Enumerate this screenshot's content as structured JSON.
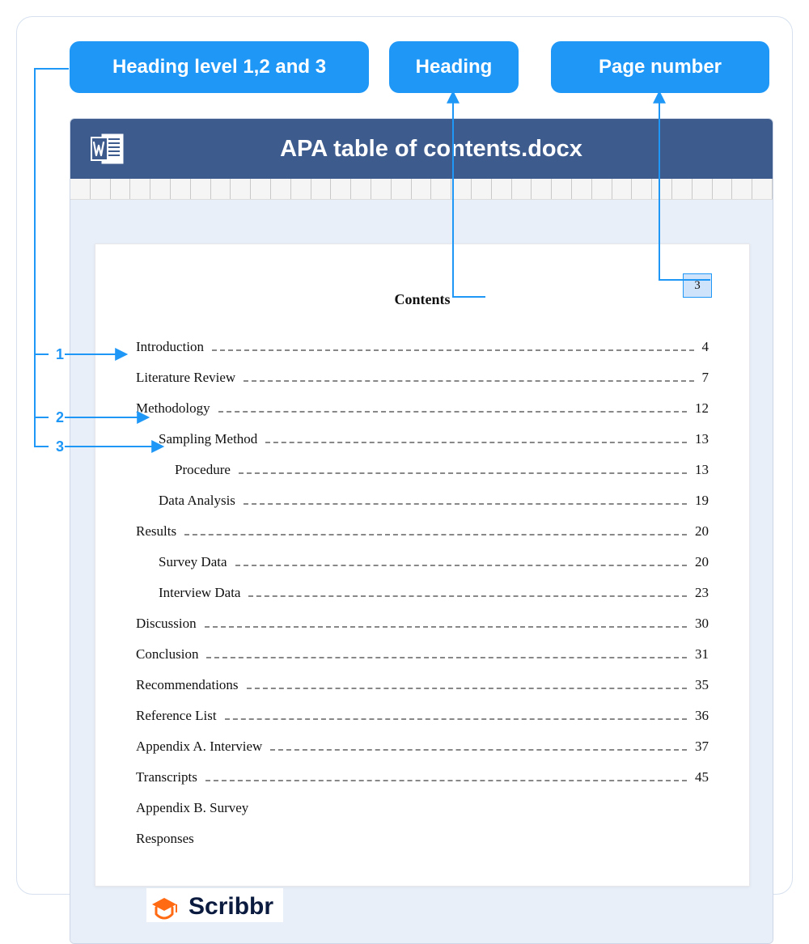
{
  "callouts": {
    "levels": "Heading level 1,2 and 3",
    "heading": "Heading",
    "pagenum": "Page number"
  },
  "level_markers": {
    "one": "1",
    "two": "2",
    "three": "3"
  },
  "document": {
    "filename": "APA table of contents.docx",
    "page_number": "3",
    "toc_title": "Contents",
    "entries": [
      {
        "label": "Introduction",
        "page": "4",
        "level": 1
      },
      {
        "label": "Literature Review",
        "page": "7",
        "level": 1
      },
      {
        "label": "Methodology",
        "page": "12",
        "level": 1
      },
      {
        "label": "Sampling Method",
        "page": "13",
        "level": 2
      },
      {
        "label": "Procedure",
        "page": "13",
        "level": 3
      },
      {
        "label": "Data Analysis",
        "page": "19",
        "level": 2
      },
      {
        "label": "Results",
        "page": "20",
        "level": 1
      },
      {
        "label": "Survey Data",
        "page": "20",
        "level": 2
      },
      {
        "label": "Interview Data",
        "page": "23",
        "level": 2
      },
      {
        "label": "Discussion",
        "page": "30",
        "level": 1
      },
      {
        "label": "Conclusion",
        "page": "31",
        "level": 1
      },
      {
        "label": "Recommendations",
        "page": "35",
        "level": 1
      },
      {
        "label": "Reference List",
        "page": "36",
        "level": 1
      },
      {
        "label": "Appendix A. Interview",
        "page": "37",
        "level": 1
      },
      {
        "label": "Transcripts",
        "page": "45",
        "level": 1
      },
      {
        "label": "Appendix B. Survey",
        "page": "",
        "level": 1
      },
      {
        "label": "Responses",
        "page": "",
        "level": 1
      }
    ]
  },
  "brand": "Scribbr"
}
